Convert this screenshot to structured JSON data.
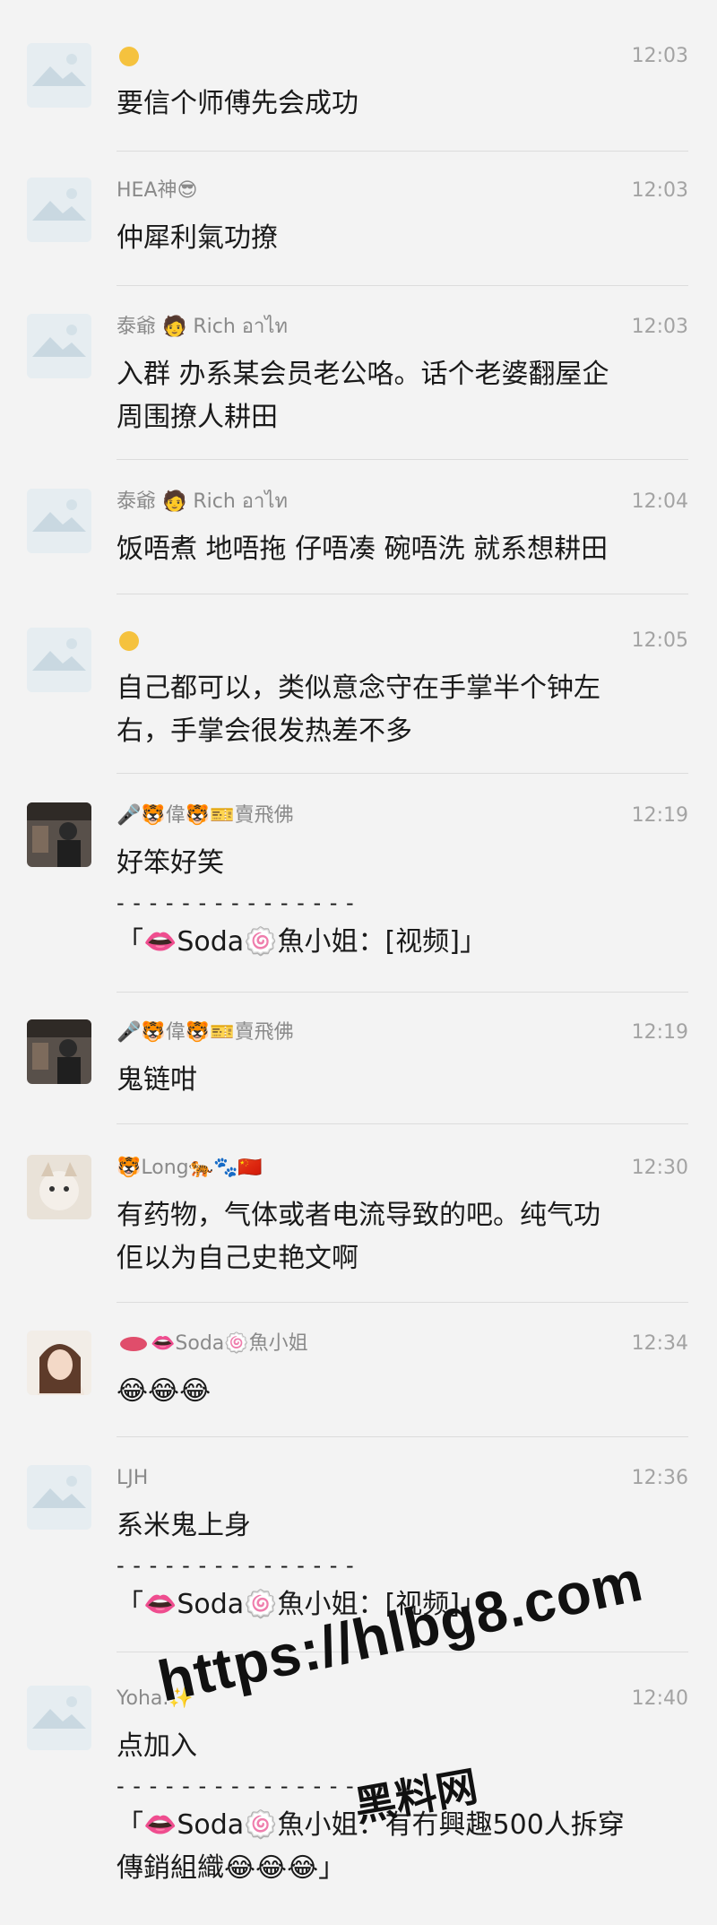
{
  "messages": [
    {
      "name": "",
      "time": "12:03",
      "lines": [
        "要信个师傅先会成功"
      ]
    },
    {
      "name": "HEA神😎",
      "time": "12:03",
      "lines": [
        "仲犀利氣功撩"
      ]
    },
    {
      "name": "泰爺 🧑 Rich อาไท",
      "time": "12:03",
      "lines": [
        "入群 办系某会员老公咯。话个老婆翻屋企",
        "周围撩人耕田"
      ]
    },
    {
      "name": "泰爺 🧑 Rich อาไท",
      "time": "12:04",
      "lines": [
        "饭唔煮 地唔拖 仔唔凑 碗唔洗 就系想耕田"
      ]
    },
    {
      "name": "",
      "time": "12:05",
      "lines": [
        "自己都可以，类似意念守在手掌半个钟左",
        "右，手掌会很发热差不多"
      ]
    },
    {
      "name": "🎤🐯偉🐯🎫賣飛佛",
      "time": "12:19",
      "lines": [
        "好笨好笑"
      ],
      "quote_sep": "- - - - - - - - - - - - - - -",
      "quote": "「👄Soda🍥魚小姐：[视频]」"
    },
    {
      "name": "🎤🐯偉🐯🎫賣飛佛",
      "time": "12:19",
      "lines": [
        "鬼链咁"
      ]
    },
    {
      "name": "🐯Long🐅🐾🇨🇳",
      "time": "12:30",
      "lines": [
        "有药物，气体或者电流导致的吧。纯气功",
        "佢以为自己史艳文啊"
      ]
    },
    {
      "name": "👄Soda🍥魚小姐",
      "time": "12:34",
      "lines": [
        "😂😂😂"
      ]
    },
    {
      "name": "LJH",
      "time": "12:36",
      "lines": [
        "系米鬼上身"
      ],
      "quote_sep": "- - - - - - - - - - - - - - -",
      "quote": "「👄Soda🍥魚小姐：[视频]」"
    },
    {
      "name": "Yoha.✨",
      "time": "12:40",
      "lines": [
        "点加入"
      ],
      "quote_sep": "- - - - - - - - - - - - - - -",
      "quote": "「👄Soda🍥魚小姐：有冇興趣500人拆穿",
      "quote2": "傳銷組織😂😂😂」"
    }
  ],
  "watermark": {
    "url": "https://hlbg8.com",
    "site": "黑料网"
  }
}
